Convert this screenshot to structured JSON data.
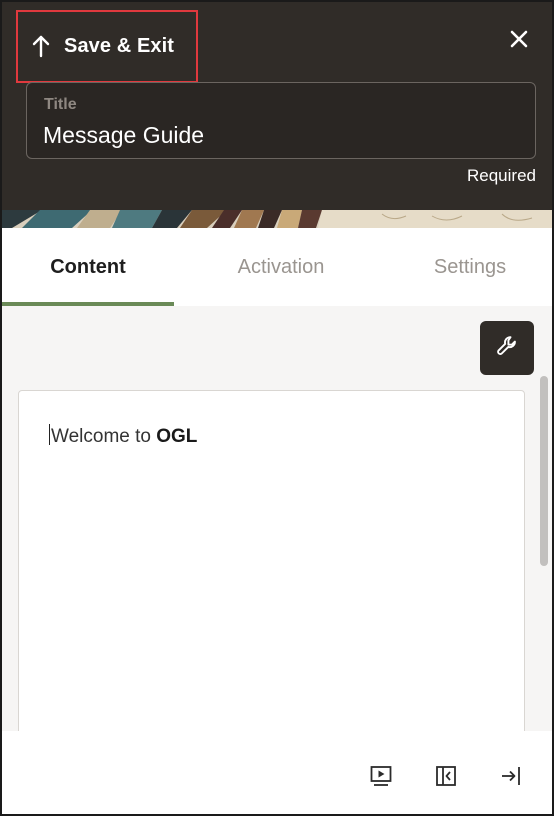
{
  "header": {
    "save_exit_label": "Save & Exit",
    "title_label": "Title",
    "title_value": "Message Guide",
    "required_text": "Required"
  },
  "tabs": [
    {
      "label": "Content",
      "active": true
    },
    {
      "label": "Activation",
      "active": false
    },
    {
      "label": "Settings",
      "active": false
    }
  ],
  "editor": {
    "text_prefix": "Welcome to ",
    "text_bold": "OGL"
  },
  "icons": {
    "save_exit": "arrow-up-icon",
    "close": "close-icon",
    "tools": "wrench-icon",
    "preview": "play-preview-icon",
    "collapse": "collapse-panel-icon",
    "exit": "exit-icon"
  },
  "colors": {
    "header_bg": "#302c28",
    "active_tab_underline": "#6a8a57",
    "highlight_border": "#e0393e"
  }
}
